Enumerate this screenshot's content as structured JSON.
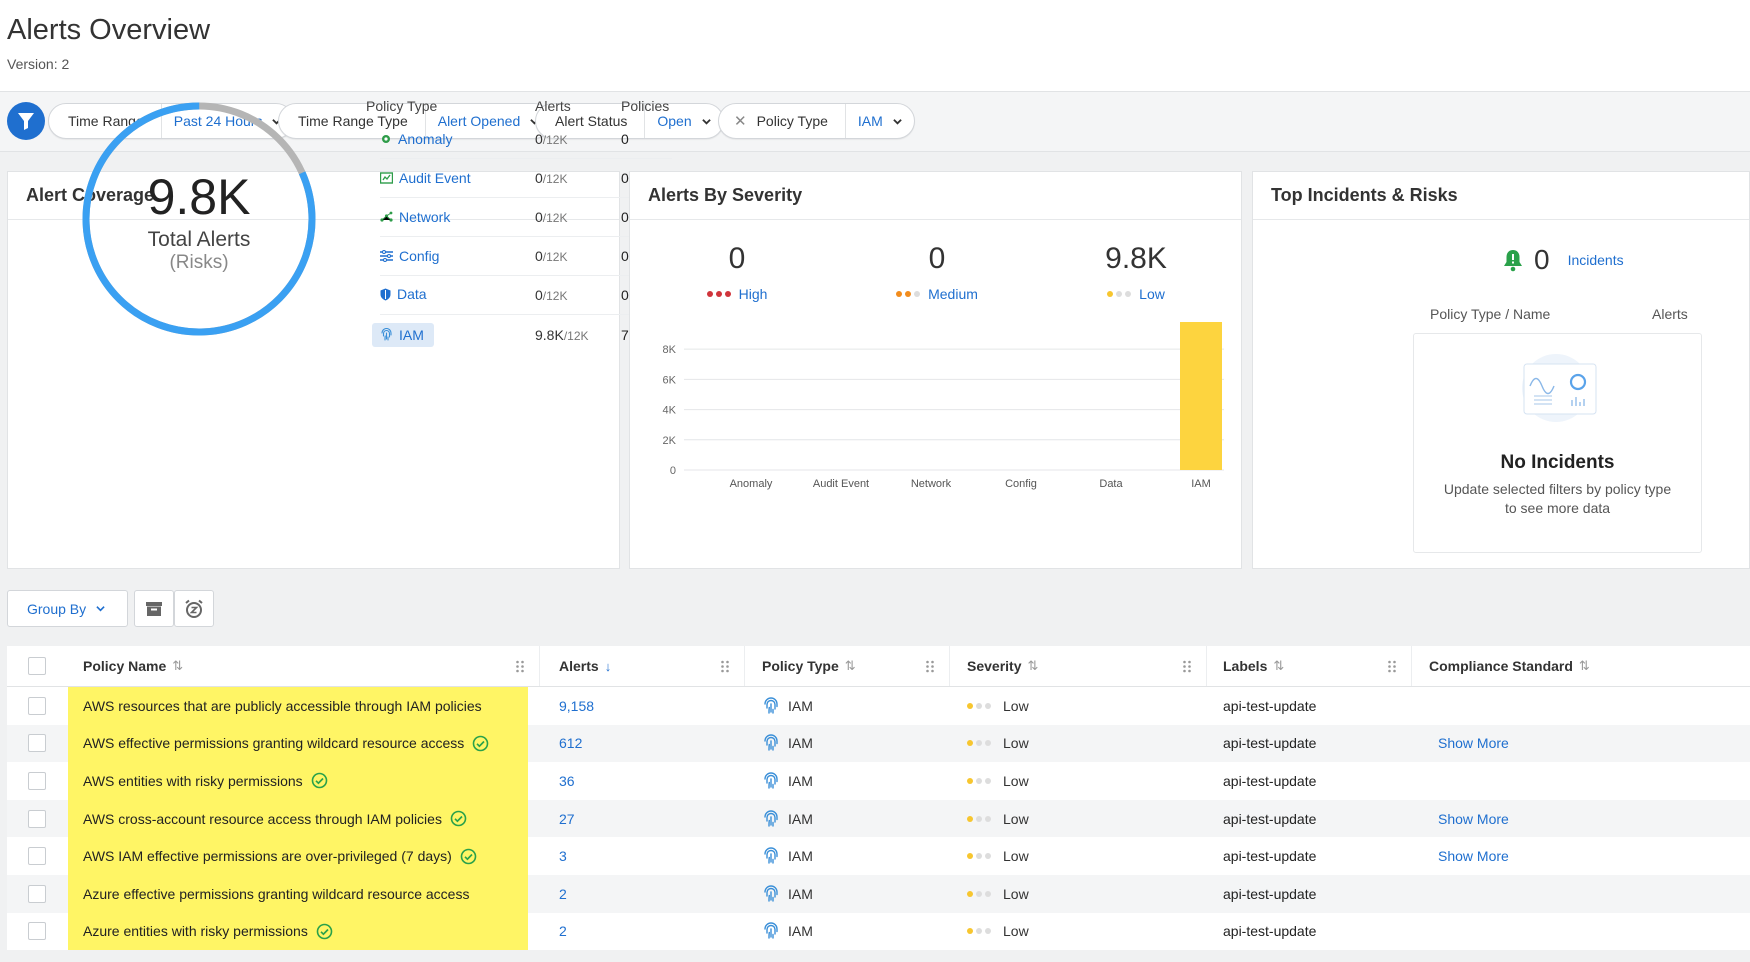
{
  "header": {
    "title": "Alerts Overview",
    "version": "Version: 2"
  },
  "filters": [
    {
      "label": "Time Range",
      "value": "Past 24 Hours",
      "removable": false
    },
    {
      "label": "Time Range Type",
      "value": "Alert Opened",
      "removable": false
    },
    {
      "label": "Alert Status",
      "value": "Open",
      "removable": false
    },
    {
      "label": "Policy Type",
      "value": "IAM",
      "removable": true
    }
  ],
  "coverage": {
    "title": "Alert Coverage",
    "total": "9.8K",
    "total_label": "Total Alerts",
    "risks_label": "(Risks)",
    "fill_fraction": 0.817,
    "headers": {
      "policy_type": "Policy Type",
      "alerts": "Alerts",
      "policies": "Policies"
    },
    "rows": [
      {
        "name": "Anomaly",
        "alerts": "0",
        "of": "/12K",
        "policies": "0",
        "icon": "anomaly-icon",
        "selected": false
      },
      {
        "name": "Audit Event",
        "alerts": "0",
        "of": "/12K",
        "policies": "0",
        "icon": "audit-event-icon",
        "selected": false
      },
      {
        "name": "Network",
        "alerts": "0",
        "of": "/12K",
        "policies": "0",
        "icon": "network-icon",
        "selected": false
      },
      {
        "name": "Config",
        "alerts": "0",
        "of": "/12K",
        "policies": "0",
        "icon": "config-icon",
        "selected": false
      },
      {
        "name": "Data",
        "alerts": "0",
        "of": "/12K",
        "policies": "0",
        "icon": "data-shield-icon",
        "selected": false
      },
      {
        "name": "IAM",
        "alerts": "9.8K",
        "of": "/12K",
        "policies": "7",
        "icon": "fingerprint-icon",
        "selected": true
      }
    ]
  },
  "severity": {
    "title": "Alerts By Severity",
    "levels": [
      {
        "count": "0",
        "label": "High",
        "color": "#d0343b"
      },
      {
        "count": "0",
        "label": "Medium",
        "color": "#f28c1c"
      },
      {
        "count": "9.8K",
        "label": "Low",
        "color": "#f7c62f"
      }
    ],
    "chart_data": {
      "type": "bar",
      "categories": [
        "Anomaly",
        "Audit Event",
        "Network",
        "Config",
        "Data",
        "IAM"
      ],
      "values": [
        0,
        0,
        0,
        0,
        0,
        9800
      ],
      "yticks": [
        "0",
        "2K",
        "4K",
        "6K",
        "8K"
      ],
      "ylim": [
        0,
        9800
      ],
      "bar_color": "#fdd43f",
      "grid": true,
      "title": "",
      "xlabel": "",
      "ylabel": ""
    }
  },
  "incidents": {
    "title": "Top Incidents & Risks",
    "count": "0",
    "label": "Incidents",
    "col_name": "Policy Type / Name",
    "col_alerts": "Alerts",
    "empty_title": "No Incidents",
    "empty_text": "Update selected filters by policy type to see more data"
  },
  "toolbar": {
    "group_by": "Group By"
  },
  "table": {
    "headers": {
      "policy_name": "Policy Name",
      "alerts": "Alerts",
      "policy_type": "Policy Type",
      "severity": "Severity",
      "labels": "Labels",
      "compliance": "Compliance Standard"
    },
    "rows": [
      {
        "name": "AWS resources that are publicly accessible through IAM policies",
        "check": false,
        "alerts": "9,158",
        "type": "IAM",
        "severity": "Low",
        "labels": "api-test-update",
        "compliance": ""
      },
      {
        "name": "AWS effective permissions granting wildcard resource access",
        "check": true,
        "alerts": "612",
        "type": "IAM",
        "severity": "Low",
        "labels": "api-test-update",
        "compliance": "Show More"
      },
      {
        "name": "AWS entities with risky permissions",
        "check": true,
        "alerts": "36",
        "type": "IAM",
        "severity": "Low",
        "labels": "api-test-update",
        "compliance": ""
      },
      {
        "name": "AWS cross-account resource access through IAM policies",
        "check": true,
        "alerts": "27",
        "type": "IAM",
        "severity": "Low",
        "labels": "api-test-update",
        "compliance": "Show More"
      },
      {
        "name": "AWS IAM effective permissions are over-privileged (7 days)",
        "check": true,
        "alerts": "3",
        "type": "IAM",
        "severity": "Low",
        "labels": "api-test-update",
        "compliance": "Show More"
      },
      {
        "name": "Azure effective permissions granting wildcard resource access",
        "check": false,
        "alerts": "2",
        "type": "IAM",
        "severity": "Low",
        "labels": "api-test-update",
        "compliance": ""
      },
      {
        "name": "Azure entities with risky permissions",
        "check": true,
        "alerts": "2",
        "type": "IAM",
        "severity": "Low",
        "labels": "api-test-update",
        "compliance": ""
      }
    ]
  }
}
